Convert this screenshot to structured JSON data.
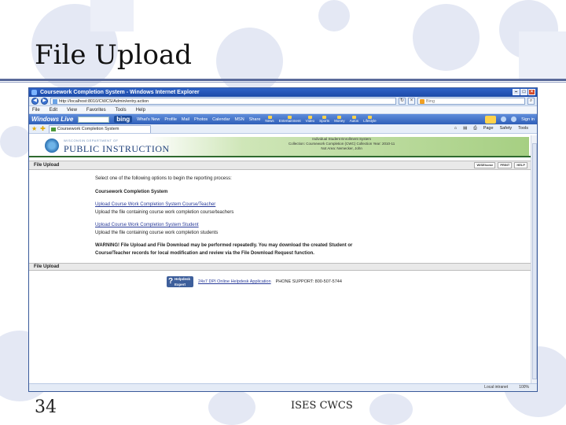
{
  "slide": {
    "title": "File Upload",
    "number": "34",
    "footer": "ISES CWCS"
  },
  "browser": {
    "window_title": "Coursework Completion System - Windows Internet Explorer",
    "url": "http://localhost:8010/CWCS/Admin/entry.action",
    "search_placeholder": "Bing",
    "menu": [
      "File",
      "Edit",
      "View",
      "Favorites",
      "Tools",
      "Help"
    ],
    "toolbar": {
      "brand": "Windows Live",
      "search_placeholder": "Bing",
      "bing": "bing",
      "items": [
        "What's New",
        "Profile",
        "Mail",
        "Photos",
        "Calendar",
        "MSN",
        "Share"
      ],
      "links": [
        "News",
        "Entertainment",
        "Video",
        "Sports",
        "Money",
        "Autos",
        "Lifestyle"
      ],
      "signin": "Sign in"
    },
    "tab_label": "Coursework Completion System",
    "commands": [
      "Page",
      "Safety",
      "Tools"
    ],
    "status": {
      "zone": "Local intranet",
      "zoom": "100%"
    }
  },
  "page": {
    "org_subtitle": "WISCONSIN DEPARTMENT OF",
    "org_name": "PUBLIC INSTRUCTION",
    "system_info": [
      "Individual Student Enrollment System",
      "Collection: Coursework Completion (CWC)    Collection Year: 2010-11",
      "Not Area: Nemecker, John"
    ],
    "section1_title": "File Upload",
    "section_icons": [
      "WISEhome",
      "PRINT",
      "HELP"
    ],
    "intro": "Select one of the following options to begin the reporting process:",
    "heading": "Coursework Completion System",
    "option1_link": "Upload Course Work Completion System Course/Teacher",
    "option1_desc": "Upload the file containing course work completion course/teachers",
    "option2_link": "Upload Course Work Completion System Student",
    "option2_desc": "Upload the file containing course work completion students",
    "warning_line1": "WARNING! File Upload and File Download may be performed repeatedly. You may download the created Student or",
    "warning_line2": "Course/Teacher records for local modification and review via the File Download Request function.",
    "section2_title": "File Upload",
    "helpdesk_logo_line1": "Helpdesk",
    "helpdesk_logo_line2": "Expert",
    "helpdesk_link": "24x7 DPI Online Helpdesk Application",
    "phone_support": "PHONE SUPPORT: 800-507-5744"
  }
}
